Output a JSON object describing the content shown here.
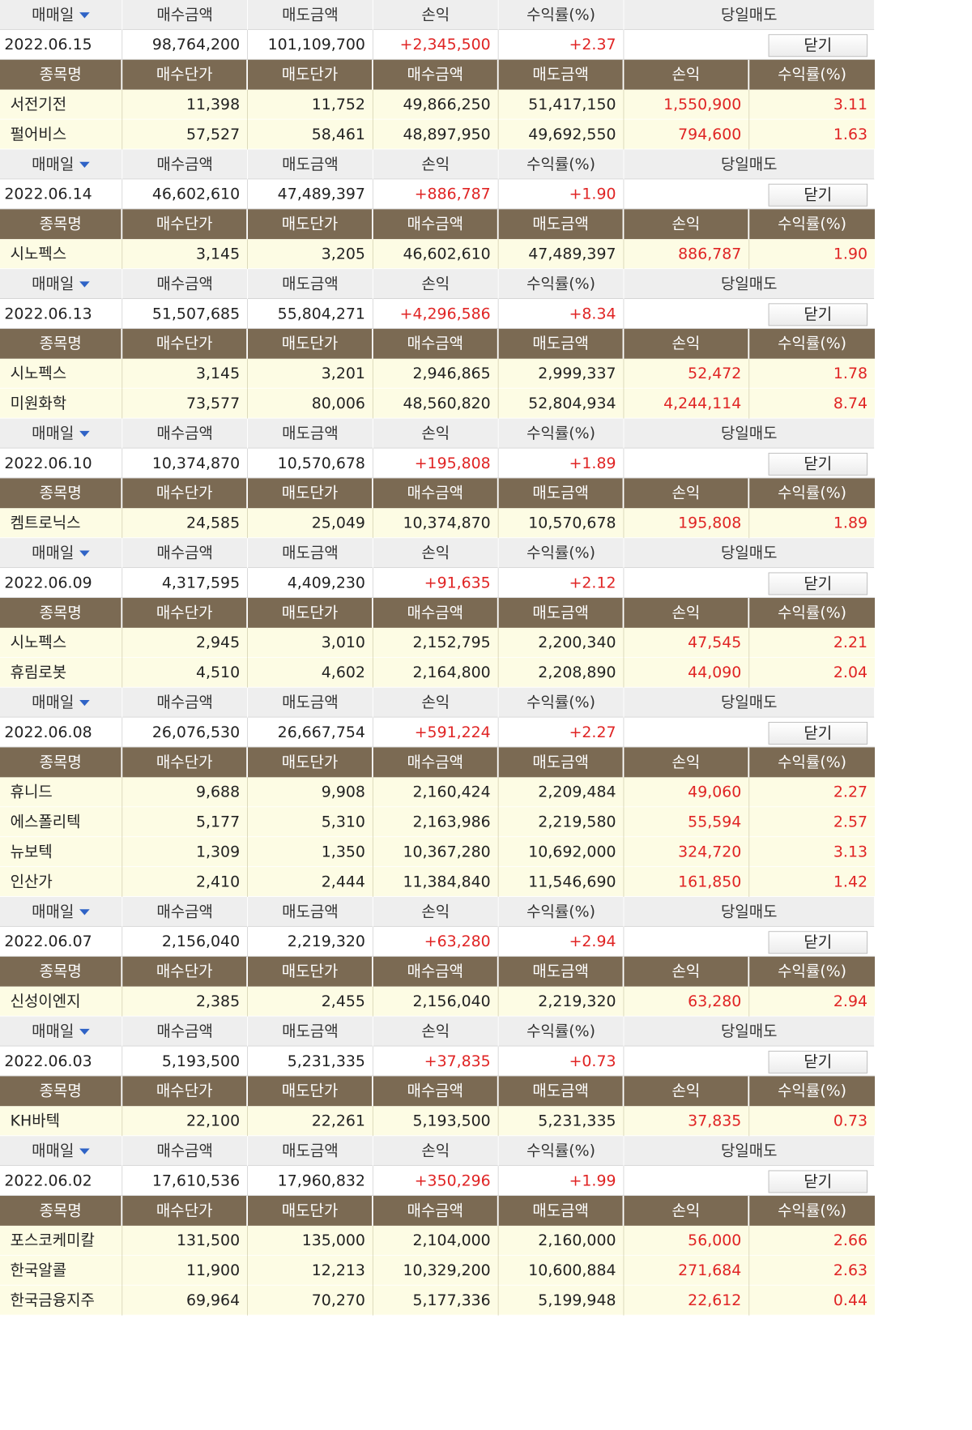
{
  "headers": {
    "date": "매매일",
    "buy_amount": "매수금액",
    "sell_amount": "매도금액",
    "pnl": "손익",
    "rate": "수익률(%)",
    "same_day_sell": "당일매도"
  },
  "item_headers": [
    "종목명",
    "매수단가",
    "매도단가",
    "매수금액",
    "매도금액",
    "손익",
    "수익률(%)"
  ],
  "close_label": "닫기",
  "colors": {
    "header_bg": "#eeeeee",
    "item_header_bg": "#7b6a53",
    "item_row_bg": "#fdfce4",
    "profit": "#e02424",
    "caret": "#2f63c6"
  },
  "days": [
    {
      "date": "2022.06.15",
      "buy": "98,764,200",
      "sell": "101,109,700",
      "pnl": "+2,345,500",
      "rate": "+2.37",
      "items": [
        [
          "서전기전",
          "11,398",
          "11,752",
          "49,866,250",
          "51,417,150",
          "1,550,900",
          "3.11"
        ],
        [
          "펄어비스",
          "57,527",
          "58,461",
          "48,897,950",
          "49,692,550",
          "794,600",
          "1.63"
        ]
      ]
    },
    {
      "date": "2022.06.14",
      "buy": "46,602,610",
      "sell": "47,489,397",
      "pnl": "+886,787",
      "rate": "+1.90",
      "items": [
        [
          "시노펙스",
          "3,145",
          "3,205",
          "46,602,610",
          "47,489,397",
          "886,787",
          "1.90"
        ]
      ]
    },
    {
      "date": "2022.06.13",
      "buy": "51,507,685",
      "sell": "55,804,271",
      "pnl": "+4,296,586",
      "rate": "+8.34",
      "items": [
        [
          "시노펙스",
          "3,145",
          "3,201",
          "2,946,865",
          "2,999,337",
          "52,472",
          "1.78"
        ],
        [
          "미원화학",
          "73,577",
          "80,006",
          "48,560,820",
          "52,804,934",
          "4,244,114",
          "8.74"
        ]
      ]
    },
    {
      "date": "2022.06.10",
      "buy": "10,374,870",
      "sell": "10,570,678",
      "pnl": "+195,808",
      "rate": "+1.89",
      "items": [
        [
          "켐트로닉스",
          "24,585",
          "25,049",
          "10,374,870",
          "10,570,678",
          "195,808",
          "1.89"
        ]
      ]
    },
    {
      "date": "2022.06.09",
      "buy": "4,317,595",
      "sell": "4,409,230",
      "pnl": "+91,635",
      "rate": "+2.12",
      "items": [
        [
          "시노펙스",
          "2,945",
          "3,010",
          "2,152,795",
          "2,200,340",
          "47,545",
          "2.21"
        ],
        [
          "휴림로봇",
          "4,510",
          "4,602",
          "2,164,800",
          "2,208,890",
          "44,090",
          "2.04"
        ]
      ]
    },
    {
      "date": "2022.06.08",
      "buy": "26,076,530",
      "sell": "26,667,754",
      "pnl": "+591,224",
      "rate": "+2.27",
      "items": [
        [
          "휴니드",
          "9,688",
          "9,908",
          "2,160,424",
          "2,209,484",
          "49,060",
          "2.27"
        ],
        [
          "에스폴리텍",
          "5,177",
          "5,310",
          "2,163,986",
          "2,219,580",
          "55,594",
          "2.57"
        ],
        [
          "뉴보텍",
          "1,309",
          "1,350",
          "10,367,280",
          "10,692,000",
          "324,720",
          "3.13"
        ],
        [
          "인산가",
          "2,410",
          "2,444",
          "11,384,840",
          "11,546,690",
          "161,850",
          "1.42"
        ]
      ]
    },
    {
      "date": "2022.06.07",
      "buy": "2,156,040",
      "sell": "2,219,320",
      "pnl": "+63,280",
      "rate": "+2.94",
      "items": [
        [
          "신성이엔지",
          "2,385",
          "2,455",
          "2,156,040",
          "2,219,320",
          "63,280",
          "2.94"
        ]
      ]
    },
    {
      "date": "2022.06.03",
      "buy": "5,193,500",
      "sell": "5,231,335",
      "pnl": "+37,835",
      "rate": "+0.73",
      "items": [
        [
          "KH바텍",
          "22,100",
          "22,261",
          "5,193,500",
          "5,231,335",
          "37,835",
          "0.73"
        ]
      ]
    },
    {
      "date": "2022.06.02",
      "buy": "17,610,536",
      "sell": "17,960,832",
      "pnl": "+350,296",
      "rate": "+1.99",
      "items": [
        [
          "포스코케미칼",
          "131,500",
          "135,000",
          "2,104,000",
          "2,160,000",
          "56,000",
          "2.66"
        ],
        [
          "한국알콜",
          "11,900",
          "12,213",
          "10,329,200",
          "10,600,884",
          "271,684",
          "2.63"
        ],
        [
          "한국금융지주",
          "69,964",
          "70,270",
          "5,177,336",
          "5,199,948",
          "22,612",
          "0.44"
        ]
      ]
    }
  ]
}
